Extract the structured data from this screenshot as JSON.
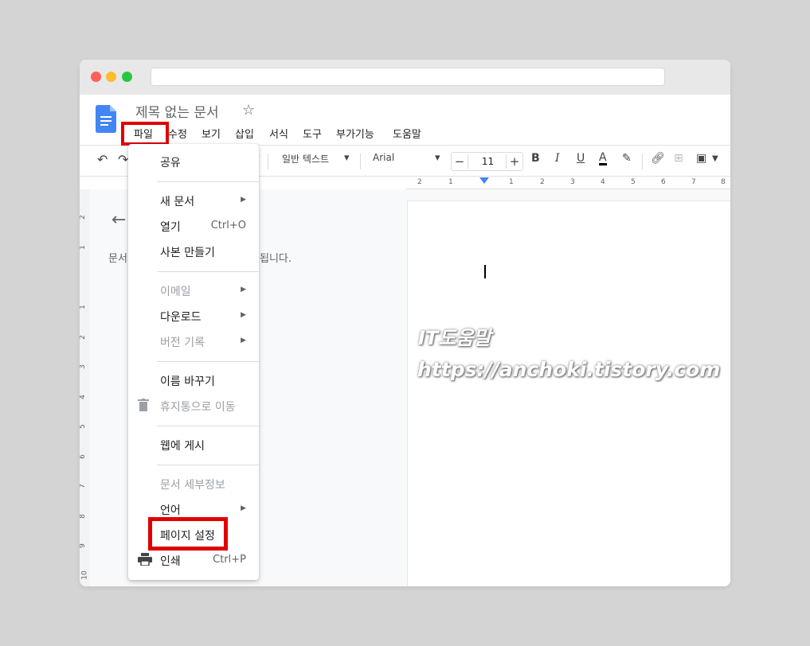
{
  "document": {
    "title": "제목 없는 문서"
  },
  "menubar": {
    "items": [
      "파일",
      "수정",
      "보기",
      "삽입",
      "서식",
      "도구",
      "부가기능",
      "도움말"
    ]
  },
  "toolbar": {
    "style": "일반 텍스트",
    "font": "Arial",
    "font_size": "11",
    "bold": "B",
    "italic": "I",
    "underline": "U",
    "text_color": "A"
  },
  "ruler": {
    "horizontal_labels": [
      "2",
      "1",
      "1",
      "2",
      "3",
      "4",
      "5",
      "6",
      "7",
      "8"
    ],
    "vertical_labels": [
      "2",
      "1",
      "1",
      "2",
      "3",
      "4",
      "5",
      "6",
      "7",
      "8",
      "9",
      "10"
    ]
  },
  "outline": {
    "text_left": "문서",
    "text_right": "됩니다."
  },
  "file_menu": {
    "share": "공유",
    "new_document": "새 문서",
    "open": "열기",
    "open_shortcut": "Ctrl+O",
    "make_copy": "사본 만들기",
    "email": "이메일",
    "download": "다운로드",
    "version_history": "버전 기록",
    "rename": "이름 바꾸기",
    "move_to_trash": "휴지통으로 이동",
    "publish_web": "웹에 게시",
    "document_details": "문서 세부정보",
    "language": "언어",
    "page_setup": "페이지 설정",
    "print": "인쇄",
    "print_shortcut": "Ctrl+P"
  },
  "watermark": {
    "line1": "IT도움말",
    "line2": "https://anchoki.tistory.com"
  },
  "colors": {
    "highlight": "#e00000",
    "docs_blue": "#4285f4"
  }
}
